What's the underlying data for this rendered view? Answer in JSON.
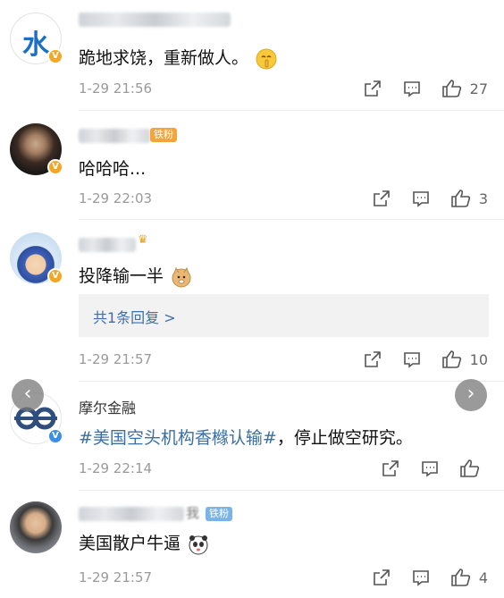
{
  "colors": {
    "accent_link": "#3a6ea5",
    "fan_badge": "#f4a53a",
    "verify_badge": "#f5a623"
  },
  "comments": [
    {
      "avatar_icon": "shui-character-avatar",
      "avatar_char": "水",
      "text": "跪地求饶，重新做人。",
      "time": "1-29 21:56",
      "likes": "27"
    },
    {
      "avatar_icon": "person-photo-avatar",
      "fan_badge": "铁粉",
      "text": "哈哈哈...",
      "time": "1-29 22:03",
      "likes": "3"
    },
    {
      "avatar_icon": "cartoon-avatar",
      "text": "投降输一半",
      "time": "1-29 21:57",
      "likes": "10",
      "reply_link": "共1条回复 >"
    },
    {
      "avatar_icon": "infinity-logo-avatar",
      "username": "摩尔金融",
      "text_tag": "#美国空头机构香橼认输#",
      "text_rest": "，停止做空研究。",
      "time": "1-29 22:14",
      "likes": ""
    },
    {
      "avatar_icon": "person-photo-avatar",
      "username_suffix": "我",
      "fan_badge": "铁粉",
      "text": "美国散户牛逼",
      "time": "1-29 21:57",
      "likes": "4"
    }
  ],
  "nav": {
    "prev": "‹",
    "next": "›"
  }
}
